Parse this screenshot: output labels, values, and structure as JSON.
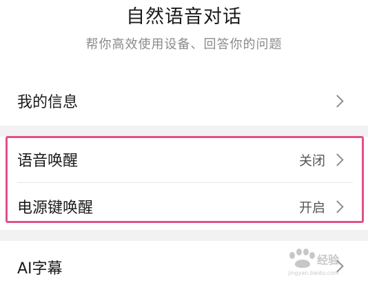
{
  "header": {
    "title": "自然语音对话",
    "subtitle": "帮你高效使用设备、回答你的问题"
  },
  "rows": {
    "my_info": {
      "label": "我的信息"
    },
    "voice_wake": {
      "label": "语音唤醒",
      "value": "关闭"
    },
    "power_key_wake": {
      "label": "电源键唤醒",
      "value": "开启"
    },
    "ai_subtitles": {
      "label": "AI字幕"
    }
  },
  "watermark": {
    "text": "Baidu经验",
    "url": "jingyan.baidu.com"
  },
  "colors": {
    "highlight": "#e0508a",
    "section_gap": "#f2f2f2"
  }
}
